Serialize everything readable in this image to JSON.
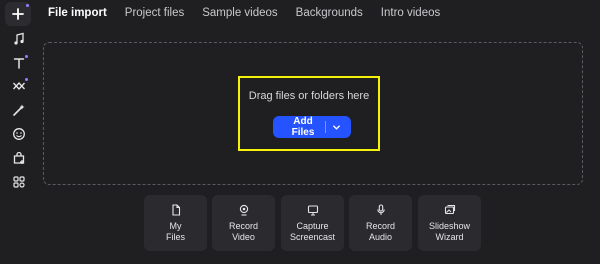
{
  "tabs": [
    {
      "label": "File import",
      "active": true
    },
    {
      "label": "Project files",
      "active": false
    },
    {
      "label": "Sample videos",
      "active": false
    },
    {
      "label": "Backgrounds",
      "active": false
    },
    {
      "label": "Intro videos",
      "active": false
    }
  ],
  "rail": {
    "icons": [
      "plus-icon",
      "music-icon",
      "text-icon",
      "transitions-icon",
      "effects-icon",
      "stickers-icon",
      "shop-icon",
      "more-icon"
    ]
  },
  "dropzone": {
    "prompt": "Drag files or folders here",
    "add_button_label": "Add Files"
  },
  "tiles": [
    {
      "label": "My\nFiles",
      "icon": "file-icon"
    },
    {
      "label": "Record\nVideo",
      "icon": "webcam-icon"
    },
    {
      "label": "Capture\nScreencast",
      "icon": "screen-icon"
    },
    {
      "label": "Record\nAudio",
      "icon": "mic-icon"
    },
    {
      "label": "Slideshow\nWizard",
      "icon": "slideshow-icon"
    }
  ],
  "colors": {
    "background": "#1f1f21",
    "accent": "#2453ff",
    "highlight": "#f4f20a",
    "badge": "#9b7cff"
  }
}
